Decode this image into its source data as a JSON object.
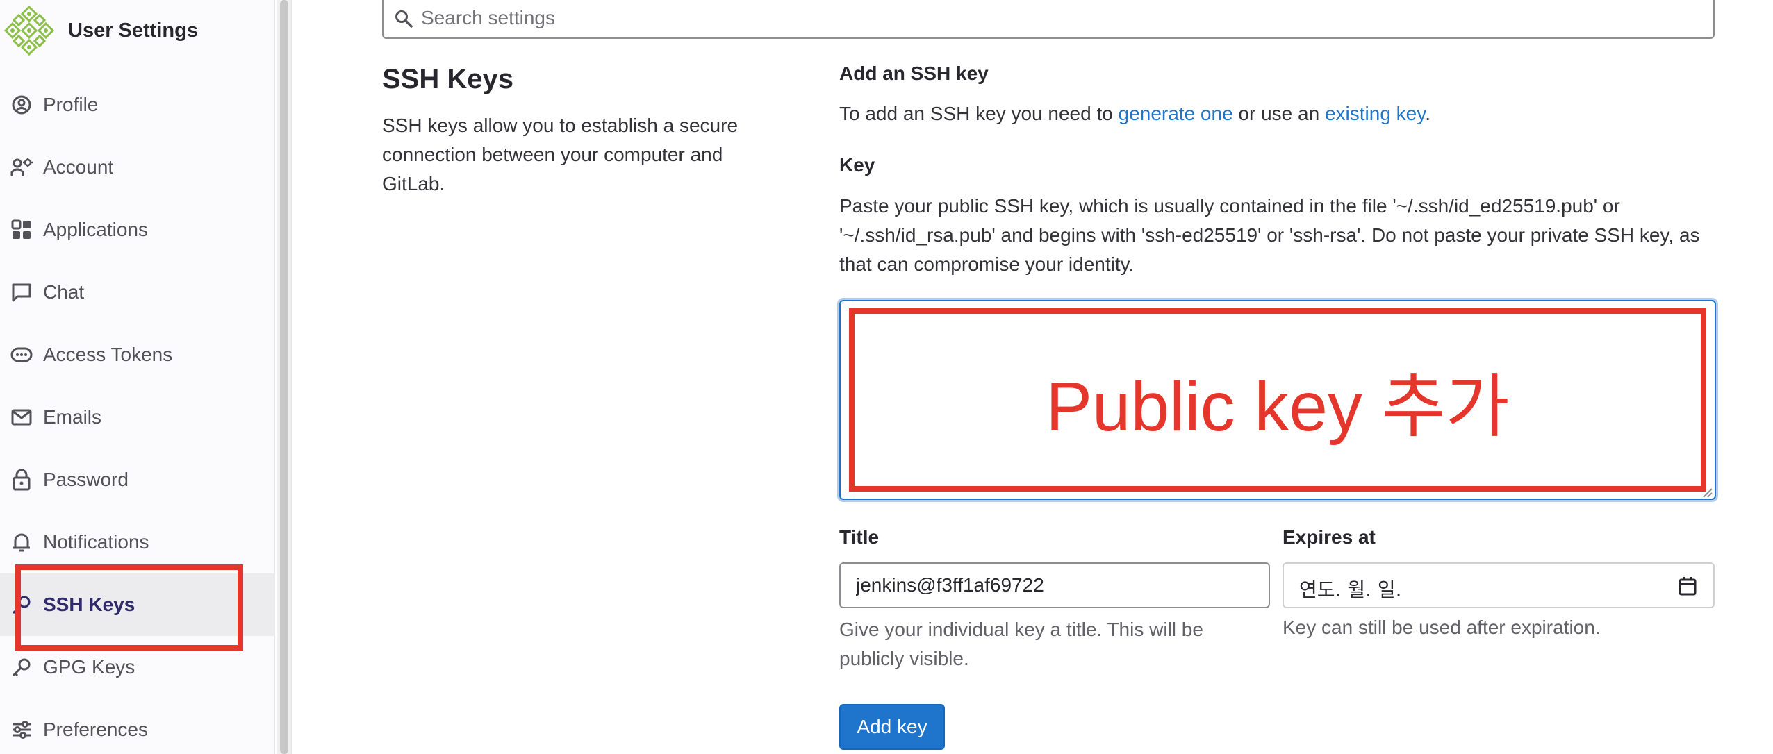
{
  "sidebar": {
    "title": "User Settings",
    "items": [
      {
        "label": "Profile",
        "icon": "profile-icon"
      },
      {
        "label": "Account",
        "icon": "account-icon"
      },
      {
        "label": "Applications",
        "icon": "applications-icon"
      },
      {
        "label": "Chat",
        "icon": "chat-icon"
      },
      {
        "label": "Access Tokens",
        "icon": "token-icon"
      },
      {
        "label": "Emails",
        "icon": "mail-icon"
      },
      {
        "label": "Password",
        "icon": "lock-icon"
      },
      {
        "label": "Notifications",
        "icon": "bell-icon"
      },
      {
        "label": "SSH Keys",
        "icon": "key-icon",
        "active": true
      },
      {
        "label": "GPG Keys",
        "icon": "key-icon"
      },
      {
        "label": "Preferences",
        "icon": "preferences-icon"
      }
    ]
  },
  "search": {
    "placeholder": "Search settings"
  },
  "section": {
    "title": "SSH Keys",
    "description": "SSH keys allow you to establish a secure connection between your computer and GitLab."
  },
  "form": {
    "heading": "Add an SSH key",
    "help_prefix": "To add an SSH key you need to ",
    "link_generate": "generate one",
    "help_middle": " or use an ",
    "link_existing": "existing key",
    "help_suffix": ".",
    "key_label": "Key",
    "key_help": "Paste your public SSH key, which is usually contained in the file '~/.ssh/id_ed25519.pub' or '~/.ssh/id_rsa.pub' and begins with 'ssh-ed25519' or 'ssh-rsa'. Do not paste your private SSH key, as that can compromise your identity.",
    "key_annotation": "Public key 추가",
    "title_label": "Title",
    "title_value": "jenkins@f3ff1af69722",
    "title_help": "Give your individual key a title. This will be publicly visible.",
    "expires_label": "Expires at",
    "expires_value": "연도. 월. 일.",
    "expires_help": "Key can still be used after expiration.",
    "submit_label": "Add key"
  },
  "colors": {
    "accent": "#1f75cb",
    "annotation": "#e5362b",
    "active_text": "#2f2a6b"
  }
}
